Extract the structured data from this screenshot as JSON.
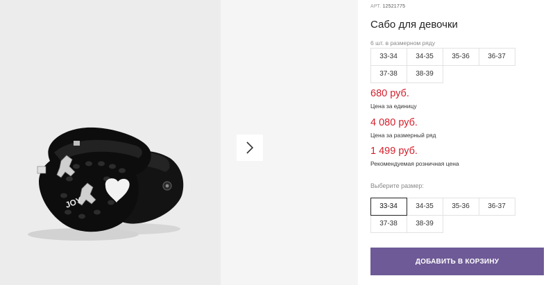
{
  "gallery": {
    "next_icon": "chevron-right-icon",
    "shoe_text": "JOY"
  },
  "product": {
    "article_label": "АРТ.",
    "article_number": "12521775",
    "title": "Сабо для девочки",
    "pack_note": "6 шт. в размерном ряду",
    "pack_sizes": [
      "33-34",
      "34-35",
      "35-36",
      "36-37",
      "37-38",
      "38-39"
    ],
    "prices": {
      "unit_price": "680 руб.",
      "unit_label": "Цена за единицу",
      "pack_price": "4 080 руб.",
      "pack_label": "Цена за размерный ряд",
      "retail_price": "1 499 руб.",
      "retail_label": "Рекомендуемая розничная цена"
    },
    "select_label": "Выберите размер:",
    "select_sizes": [
      "33-34",
      "34-35",
      "35-36",
      "36-37",
      "37-38",
      "38-39"
    ],
    "selected_size": "33-34",
    "cart_button": "ДОБАВИТЬ В КОРЗИНУ"
  },
  "colors": {
    "price": "#d41f2b",
    "cart_button": "#6e5a96"
  }
}
